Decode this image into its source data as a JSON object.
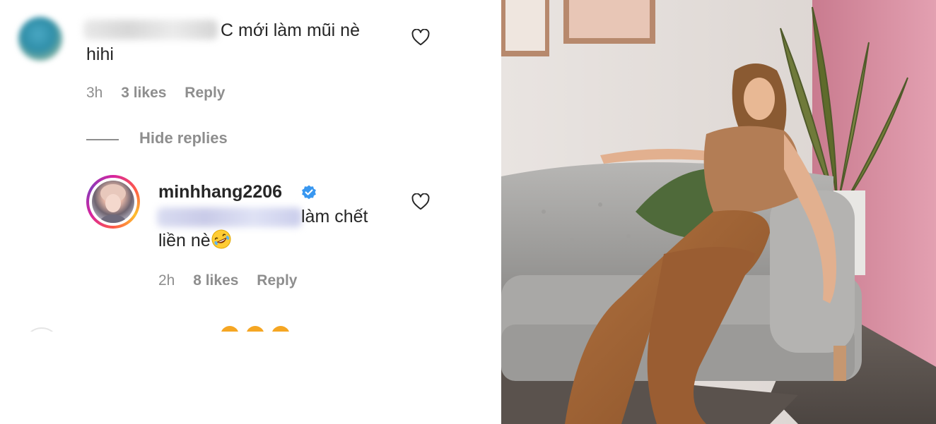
{
  "comment1": {
    "text_line1": "C mới làm mũi nè",
    "text_line2": "hihi",
    "time": "3h",
    "likes": "3 likes",
    "reply": "Reply"
  },
  "hide_replies": "Hide replies",
  "reply1": {
    "username": "minhhang2206",
    "text_line1": "làm chết",
    "text_line2": "liền nè",
    "emoji": "rolling-on-floor-laughing",
    "time": "2h",
    "likes": "8 likes",
    "reply": "Reply"
  },
  "colors": {
    "text": "#262626",
    "meta": "#8e8e8e",
    "verified": "#3897f0",
    "wall_pink": "#d68ea0"
  }
}
